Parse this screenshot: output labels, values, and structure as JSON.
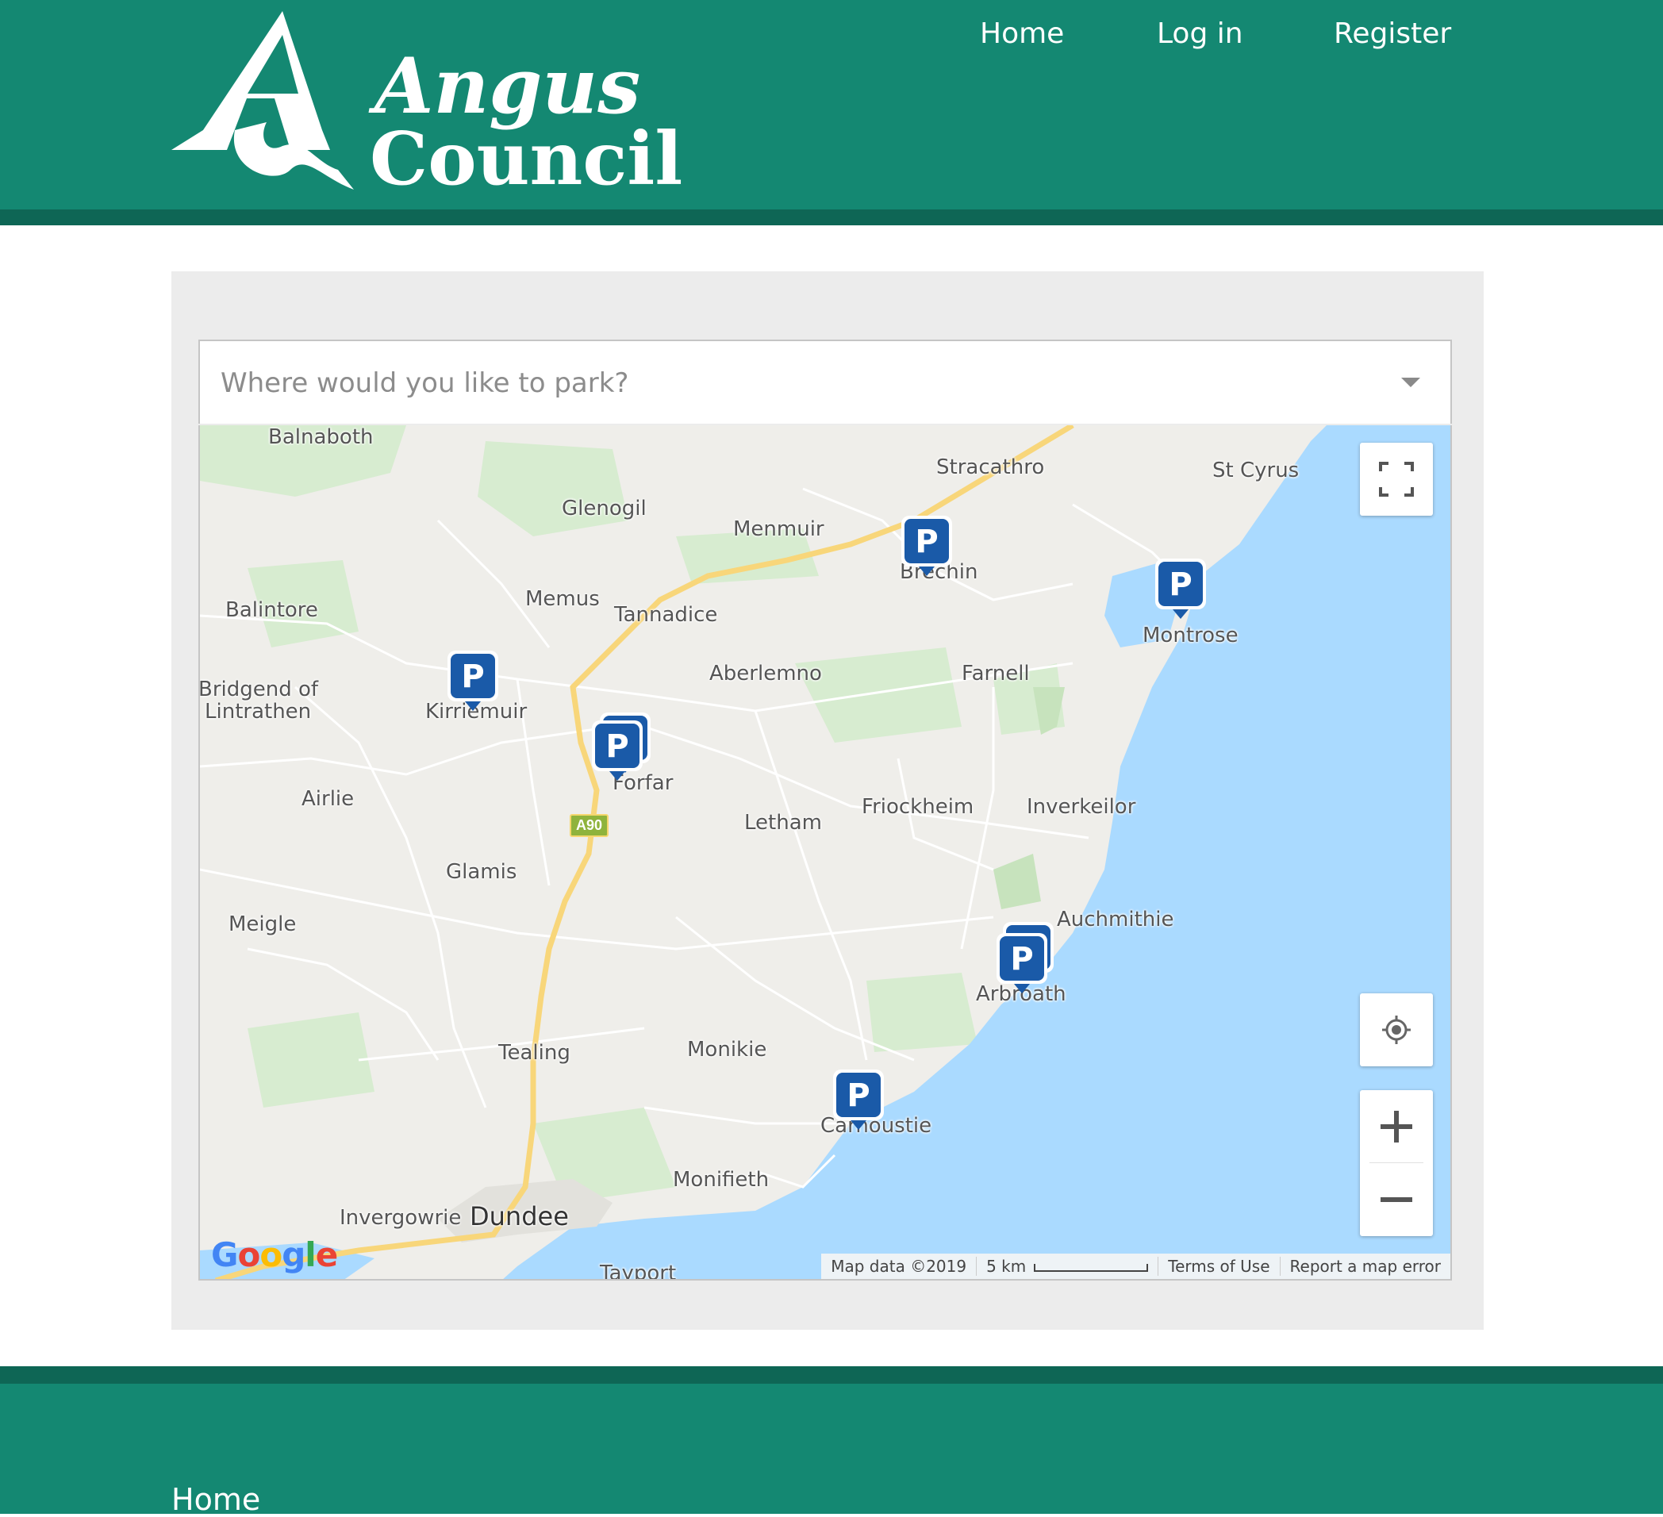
{
  "brand": {
    "logo_line1": "Angus",
    "logo_line2": "Council",
    "primary_color": "#148872",
    "dark_color": "#0e6655"
  },
  "nav": {
    "items": [
      {
        "label": "Home"
      },
      {
        "label": "Log in"
      },
      {
        "label": "Register"
      }
    ]
  },
  "search": {
    "placeholder": "Where would you like to park?"
  },
  "map": {
    "places": [
      "Balnaboth",
      "Stracathro",
      "St Cyrus",
      "Glenogil",
      "Menmuir",
      "Balintore",
      "Memus",
      "Tannadice",
      "Montrose",
      "Bridgend of",
      "Lintrathen",
      "Aberlemno",
      "Farnell",
      "Airlie",
      "Letham",
      "Friockheim",
      "Inverkeilor",
      "Glamis",
      "Meigle",
      "Auchmithie",
      "Tealing",
      "Monikie",
      "Monifieth",
      "Invergowrie",
      "Dundee",
      "Tayport"
    ],
    "partial_labels": [
      "Brechin",
      "Kirriemuir",
      "Forfar",
      "Arbroath",
      "Carnoustie"
    ],
    "road_label": "A90",
    "marker_icon": "parking-marker-icon",
    "marker_color": "#1a5aa8",
    "attribution": {
      "map_data": "Map data ©2019",
      "scale": "5 km",
      "terms": "Terms of Use",
      "report": "Report a map error"
    },
    "google_letters": [
      "G",
      "o",
      "o",
      "g",
      "l",
      "e"
    ]
  },
  "footer": {
    "home_label": "Home"
  }
}
